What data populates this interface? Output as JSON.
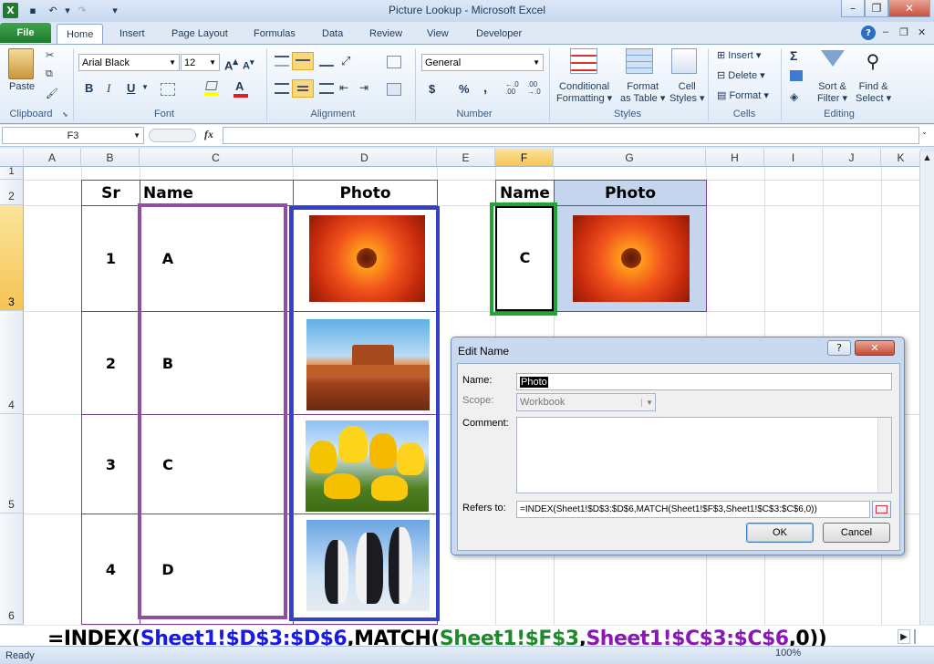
{
  "window": {
    "title": "Picture Lookup  -  Microsoft Excel"
  },
  "tabs": [
    "File",
    "Home",
    "Insert",
    "Page Layout",
    "Formulas",
    "Data",
    "Review",
    "View",
    "Developer"
  ],
  "ribbon": {
    "clipboard": {
      "paste": "Paste",
      "label": "Clipboard"
    },
    "font": {
      "name": "Arial Black",
      "size": "12",
      "label": "Font",
      "bold": "B",
      "italic": "I",
      "underline": "U"
    },
    "alignment": {
      "label": "Alignment"
    },
    "number": {
      "format": "General",
      "label": "Number",
      "currency": "$",
      "percent": "%",
      "comma": ","
    },
    "styles": {
      "conditional": [
        "Conditional",
        "Formatting"
      ],
      "format_table": [
        "Format",
        "as Table"
      ],
      "cell_styles": [
        "Cell",
        "Styles"
      ],
      "label": "Styles"
    },
    "cells": {
      "insert": "Insert",
      "delete": "Delete",
      "format": "Format",
      "label": "Cells"
    },
    "editing": {
      "sort": [
        "Sort &",
        "Filter"
      ],
      "find": [
        "Find &",
        "Select"
      ],
      "label": "Editing",
      "sigma": "Σ"
    }
  },
  "formula_bar": {
    "namebox": "F3",
    "fx": "fx",
    "value": ""
  },
  "columns": [
    "A",
    "B",
    "C",
    "D",
    "E",
    "F",
    "G",
    "H",
    "I",
    "J",
    "K"
  ],
  "rows": [
    "1",
    "2",
    "3",
    "4",
    "5",
    "6"
  ],
  "sheet": {
    "header_sr": "Sr",
    "header_name": "Name",
    "header_photo": "Photo",
    "records": [
      {
        "sr": "1",
        "name": "A",
        "photo": "orange-flower-photo"
      },
      {
        "sr": "2",
        "name": "B",
        "photo": "desert-butte-photo"
      },
      {
        "sr": "3",
        "name": "C",
        "photo": "yellow-tulips-photo"
      },
      {
        "sr": "4",
        "name": "D",
        "photo": "penguins-photo"
      }
    ],
    "lookup_header_name": "Name",
    "lookup_header_photo": "Photo",
    "lookup_name": "C",
    "lookup_photo": "orange-flower-photo"
  },
  "dialog": {
    "title": "Edit Name",
    "help": "?",
    "close": "✕",
    "name_label": "Name:",
    "name_value": "Photo",
    "scope_label": "Scope:",
    "scope_value": "Workbook",
    "comment_label": "Comment:",
    "comment_value": "",
    "refers_label": "Refers to:",
    "refers_value": "=INDEX(Sheet1!$D$3:$D$6,MATCH(Sheet1!$F$3,Sheet1!$C$3:$C$6,0))",
    "ok": "OK",
    "cancel": "Cancel"
  },
  "big_formula": {
    "p1": "=INDEX(",
    "p2": "Sheet1!$D$3:$D$6",
    "p3": ",MATCH(",
    "p4": "Sheet1!$F$3",
    "p5": ",",
    "p6": "Sheet1!$C$3:$C$6",
    "p7": ",0))",
    "colors": {
      "black": "#000000",
      "blue": "#1a1ae6",
      "green": "#1f8a2a",
      "purple": "#8a18b5"
    }
  },
  "status": {
    "ready": "Ready",
    "zoom": "100%"
  },
  "colors": {
    "purple_border": "#8e4fa3",
    "blue_border": "#3340c8",
    "green_border": "#21a33a",
    "lookup_fill": "#c5d5ee",
    "selected_header": "#f5c453"
  }
}
